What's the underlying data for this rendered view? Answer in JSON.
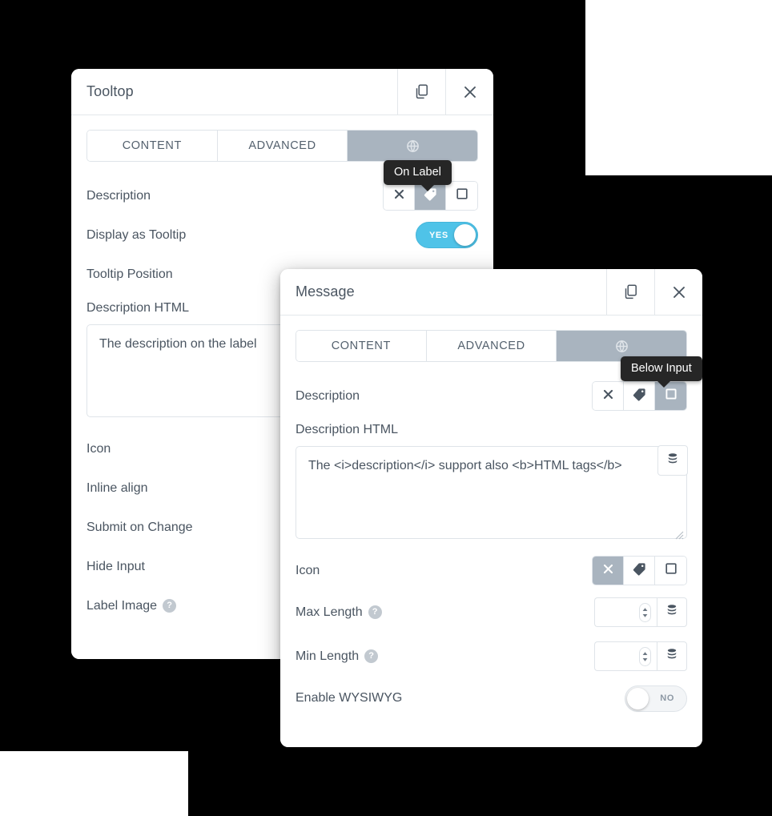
{
  "background": {
    "canvas_color": "#000000",
    "plate_color": "#ffffff"
  },
  "theme": {
    "accent_on": "#4fc3e8",
    "segment_selected": "#a9b4bf",
    "text": "#4a5561",
    "border": "#dfe4e9",
    "tooltip_bg": "#262626"
  },
  "dialogs": [
    {
      "id": "tooltop",
      "title": "Tooltop",
      "header_actions": [
        {
          "name": "duplicate-button",
          "icon": "copy-icon"
        },
        {
          "name": "close-button",
          "icon": "close-icon"
        }
      ],
      "tabs": [
        {
          "label": "CONTENT",
          "active": false
        },
        {
          "label": "ADVANCED",
          "active": false
        },
        {
          "label": "",
          "icon": "globe-icon",
          "active": true
        }
      ],
      "rows": [
        {
          "label": "Description",
          "control": "segmented",
          "selected_index": 1
        },
        {
          "label": "Display as Tooltip",
          "control": "switch",
          "state": "YES"
        },
        {
          "label": "Tooltip Position",
          "control": "hidden"
        },
        {
          "label": "Description HTML",
          "control": "textarea",
          "value": "The description on the label"
        },
        {
          "label": "Icon",
          "control": "hidden"
        },
        {
          "label": "Inline align",
          "control": "partial-input"
        },
        {
          "label": "Submit on Change",
          "control": "hidden"
        },
        {
          "label": "Hide Input",
          "control": "hidden"
        },
        {
          "label": "Label Image",
          "help": "?",
          "control": "hidden"
        }
      ],
      "tooltip": {
        "text": "On Label",
        "target": "description-tag-option"
      }
    },
    {
      "id": "message",
      "title": "Message",
      "header_actions": [
        {
          "name": "duplicate-button",
          "icon": "copy-icon"
        },
        {
          "name": "close-button",
          "icon": "close-icon"
        }
      ],
      "tabs": [
        {
          "label": "CONTENT",
          "active": false
        },
        {
          "label": "ADVANCED",
          "active": false
        },
        {
          "label": "",
          "icon": "globe-icon",
          "active": true
        }
      ],
      "rows": [
        {
          "label": "Description",
          "control": "segmented",
          "selected_index": 2
        },
        {
          "label": "Description HTML",
          "control": "textarea",
          "value": "The <i>description</i> support also <b>HTML tags</b>"
        },
        {
          "label": "Icon",
          "control": "segmented",
          "selected_index": 0
        },
        {
          "label": "Max Length",
          "help": "?",
          "control": "number",
          "value": ""
        },
        {
          "label": "Min Length",
          "help": "?",
          "control": "number",
          "value": ""
        },
        {
          "label": "Enable WYSIWYG",
          "control": "switch",
          "state": "NO"
        }
      ],
      "tooltip": {
        "text": "Below Input",
        "target": "description-box-option"
      }
    }
  ],
  "segment_icons": [
    "close-icon",
    "tag-icon",
    "square-icon"
  ],
  "switch_labels": {
    "on": "YES",
    "off": "NO"
  },
  "icon_names": {
    "copy": "copy-icon",
    "close": "close-icon",
    "tag": "tag-icon",
    "square": "square-icon",
    "database": "database-icon",
    "spinner": "spinner-arrows-icon",
    "globe": "globe-icon",
    "resize": "resize-handle-icon",
    "help": "help-icon"
  }
}
